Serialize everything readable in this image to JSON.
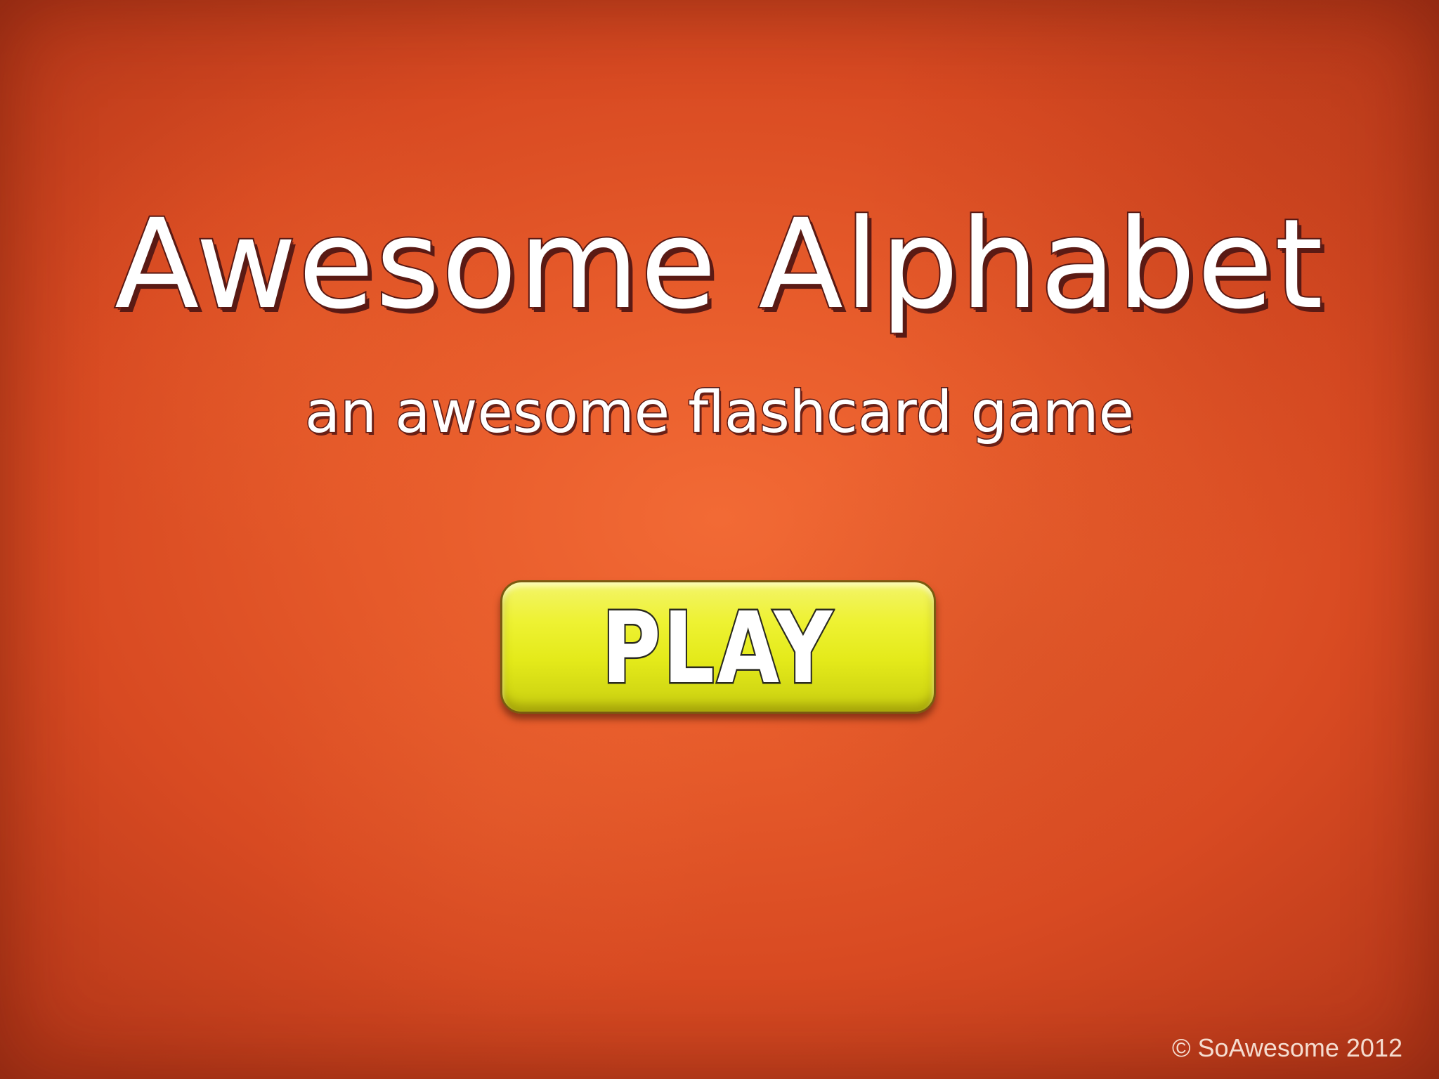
{
  "game": {
    "title": "Awesome Alphabet",
    "subtitle": "an awesome flashcard game",
    "play_label": "PLAY",
    "copyright": "© SoAwesome 2012"
  },
  "colors": {
    "background": "#e65a2a",
    "title_fill": "#ffffff",
    "title_outline": "#5a1a14",
    "play_button": "#eef233"
  }
}
